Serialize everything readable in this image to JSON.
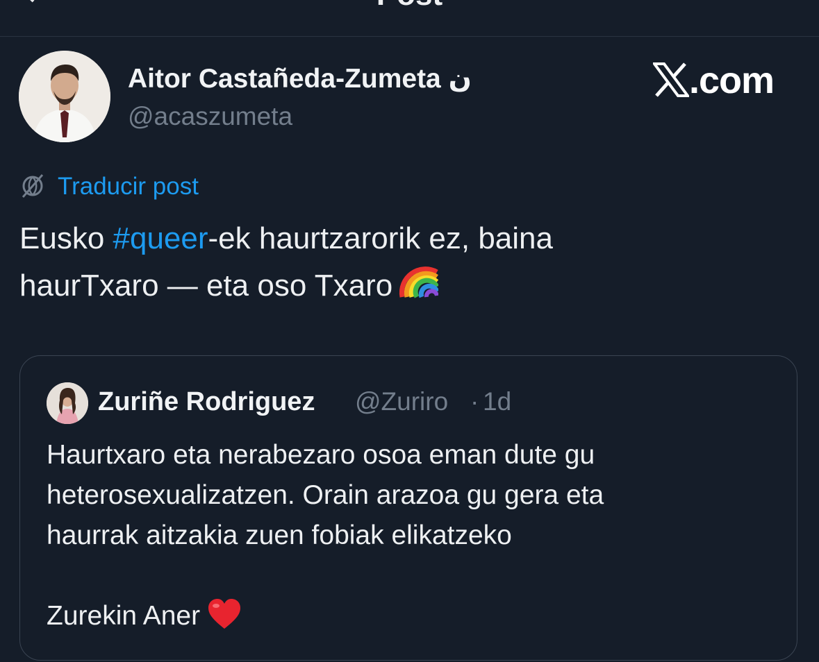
{
  "header": {
    "title": "Post",
    "back_icon": "chevron-left-icon"
  },
  "author": {
    "name": "Aitor Castañeda-Zumeta ن",
    "handle": "@acaszumeta",
    "avatar_icon": "profile-photo"
  },
  "watermark": {
    "logo_icon": "x-logo-icon",
    "text": ".com"
  },
  "translate": {
    "icon": "translate-globe-icon",
    "label": "Traducir post"
  },
  "post": {
    "line1_prefix": "Eusko ",
    "hashtag": "#queer",
    "line1_suffix": "-ek haurtzarorik ez, baina",
    "line2": "haurTxaro — eta oso Txaro",
    "emoji": "rainbow-emoji"
  },
  "quote": {
    "name": "Zuriñe Rodriguez",
    "handle": "@Zuriro",
    "separator": "·",
    "time": "1d",
    "lines": [
      "Haurtxaro eta nerabezaro osoa eman dute gu",
      "heterosexualizatzen. Orain arazoa gu gera eta",
      "haurrak aitzakia zuen fobiak elikatzeko",
      "Zurekin Aner"
    ],
    "emoji": "red-heart-emoji"
  },
  "colors": {
    "background": "#151d29",
    "link": "#1d9bf0",
    "muted": "#737e8c",
    "text": "#eef0f2",
    "border": "#3a4452"
  }
}
